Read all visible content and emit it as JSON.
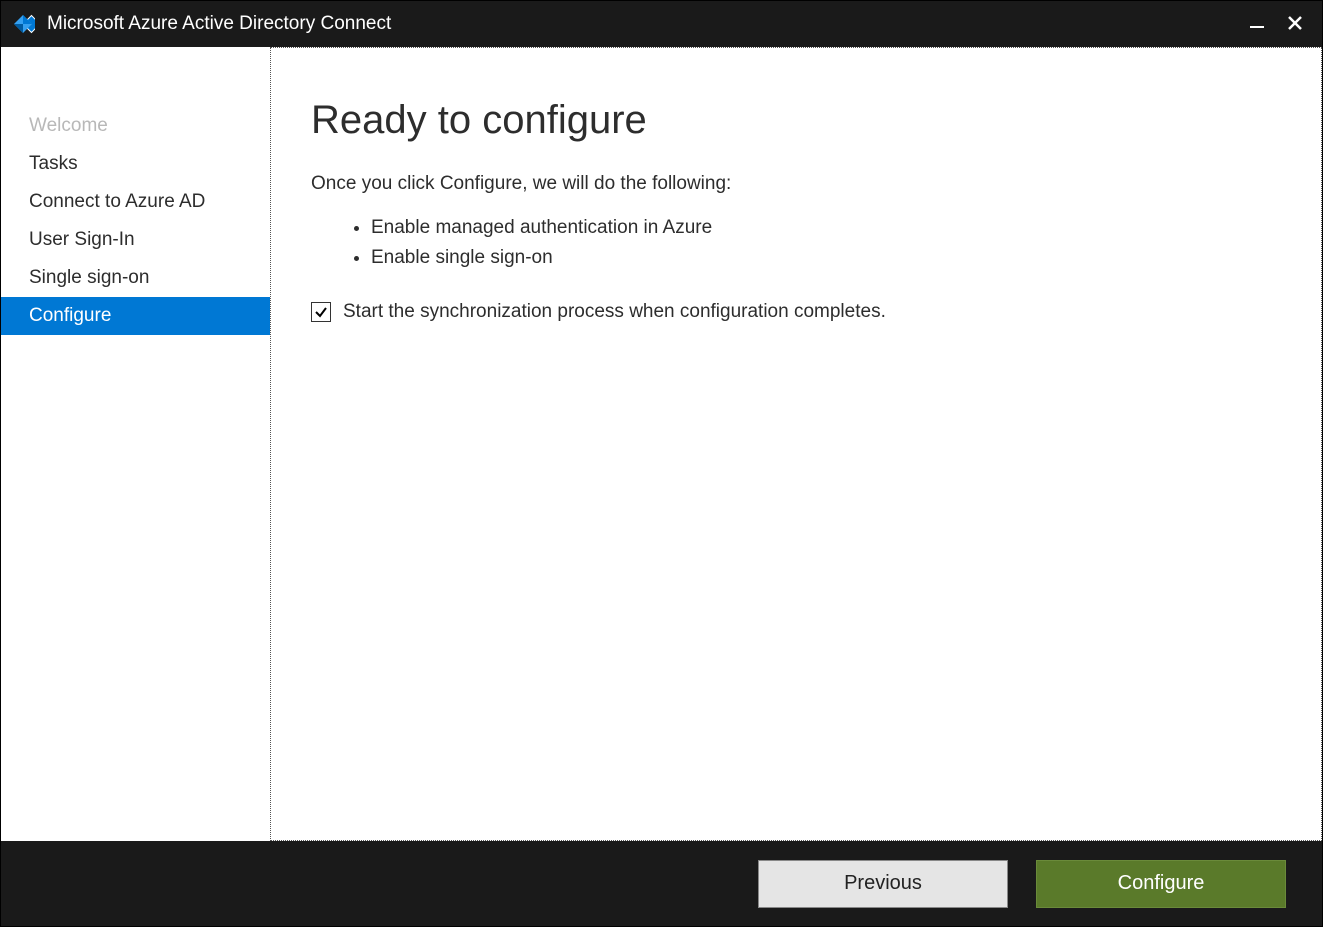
{
  "window": {
    "title": "Microsoft Azure Active Directory Connect"
  },
  "sidebar": {
    "items": [
      {
        "label": "Welcome",
        "state": "disabled"
      },
      {
        "label": "Tasks",
        "state": "normal"
      },
      {
        "label": "Connect to Azure AD",
        "state": "normal"
      },
      {
        "label": "User Sign-In",
        "state": "normal"
      },
      {
        "label": "Single sign-on",
        "state": "normal"
      },
      {
        "label": "Configure",
        "state": "active"
      }
    ]
  },
  "main": {
    "heading": "Ready to configure",
    "intro": "Once you click Configure, we will do the following:",
    "actions": [
      "Enable managed authentication in Azure",
      "Enable single sign-on"
    ],
    "checkbox": {
      "checked": true,
      "label": "Start the synchronization process when configuration completes."
    }
  },
  "footer": {
    "previous": "Previous",
    "configure": "Configure"
  }
}
